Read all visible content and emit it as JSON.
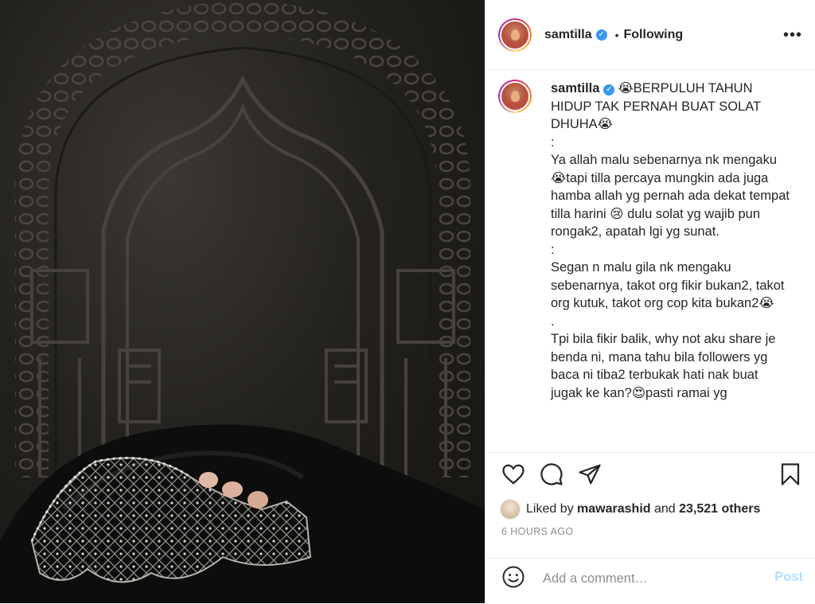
{
  "post": {
    "username": "samtilla",
    "follow_status": "Following",
    "more_label": "•••"
  },
  "caption": {
    "username": "samtilla",
    "text": "😭BERPULUH TAHUN HIDUP TAK PERNAH BUAT SOLAT DHUHA😭\n:\nYa allah malu sebenarnya nk mengaku😭tapi tilla percaya mungkin ada juga hamba allah yg pernah ada dekat tempat tilla harini 😢 dulu solat yg wajib pun rongak2, apatah lgi yg sunat.\n:\nSegan n malu gila nk mengaku sebenarnya, takot org fikir bukan2, takot org kutuk, takot org cop kita bukan2😭\n.\nTpi bila fikir balik, why not aku share je benda ni, mana tahu bila followers yg baca ni tiba2 terbukak hati nak buat jugak ke kan?😍pasti ramai yg"
  },
  "likes": {
    "prefix": "Liked by",
    "liker": "mawarashid",
    "conjunction": "and",
    "others": "23,521 others"
  },
  "timestamp": "6 HOURS AGO",
  "comment": {
    "placeholder": "Add a comment…",
    "post_label": "Post"
  },
  "icons": [
    "heart-icon",
    "comment-icon",
    "share-icon",
    "bookmark-icon",
    "smiley-icon",
    "verified-icon",
    "more-icon"
  ],
  "colors": {
    "verified": "#3897f0",
    "post_button": "#b2dffc",
    "muted_text": "#8e8e8e",
    "text": "#262626"
  }
}
